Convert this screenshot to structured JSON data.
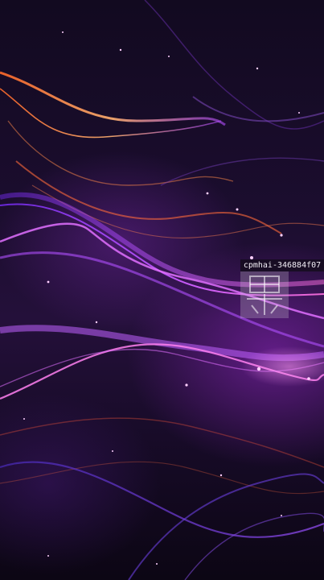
{
  "image": {
    "subject": "abstract purple and orange flowing light waves wallpaper"
  },
  "watermark": {
    "id_text": "cpmhai-346884f07",
    "logo_text": "图虫"
  },
  "colors": {
    "background": "#150a24",
    "primary_wave": "#b14cff",
    "accent_wave": "#ff7a3c",
    "highlight": "#f0a0ff"
  }
}
